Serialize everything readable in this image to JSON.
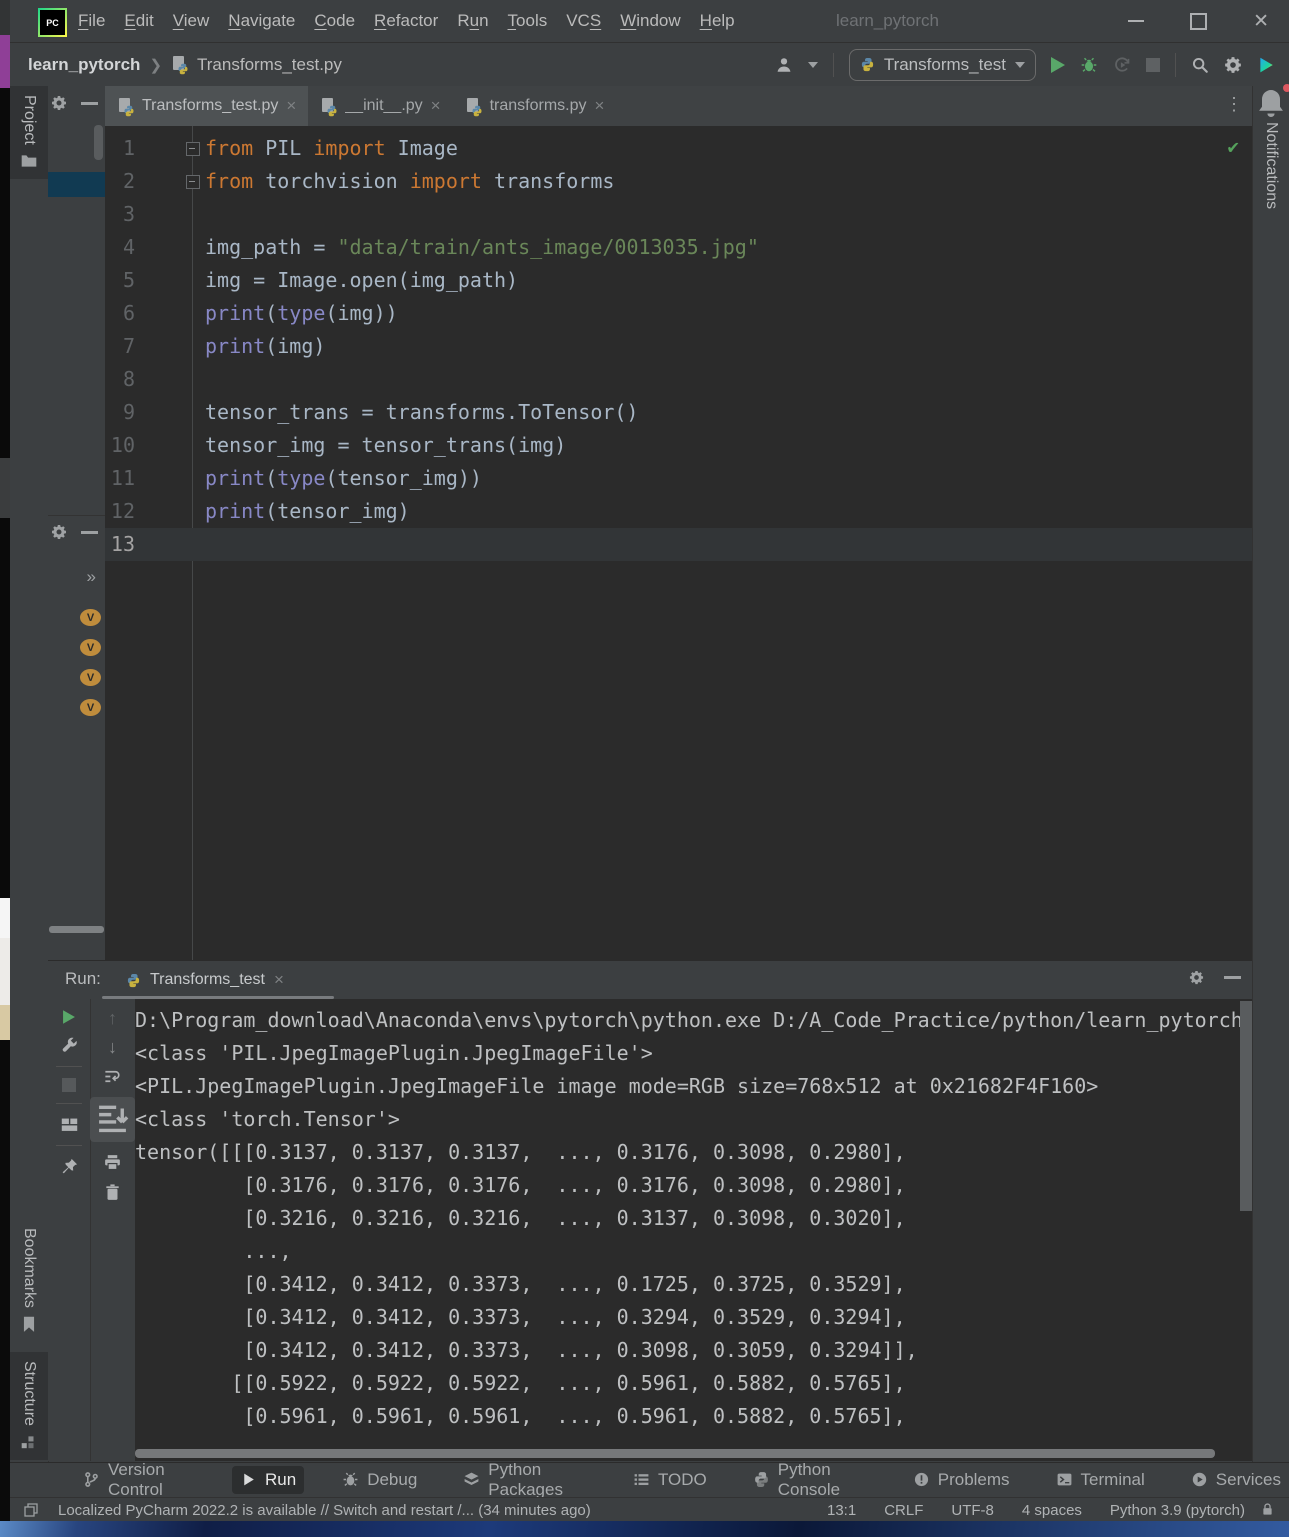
{
  "titlebar": {
    "app_label": "PC",
    "title": "learn_pytorch",
    "menus": [
      {
        "label": "File",
        "u": 0
      },
      {
        "label": "Edit",
        "u": 0
      },
      {
        "label": "View",
        "u": 0
      },
      {
        "label": "Navigate",
        "u": 0
      },
      {
        "label": "Code",
        "u": 0
      },
      {
        "label": "Refactor",
        "u": 0
      },
      {
        "label": "Run",
        "u": 1
      },
      {
        "label": "Tools",
        "u": 0
      },
      {
        "label": "VCS",
        "u": 2
      },
      {
        "label": "Window",
        "u": 0
      },
      {
        "label": "Help",
        "u": 0
      }
    ]
  },
  "toolbar": {
    "breadcrumb_project": "learn_pytorch",
    "breadcrumb_file": "Transforms_test.py",
    "run_config": "Transforms_test"
  },
  "editor": {
    "tabs": [
      {
        "label": "Transforms_test.py",
        "active": true
      },
      {
        "label": "__init__.py",
        "active": false
      },
      {
        "label": "transforms.py",
        "active": false
      }
    ],
    "current_line": 13,
    "lines": [
      {
        "n": 1,
        "t": [
          [
            "from",
            "k"
          ],
          [
            " PIL ",
            "d"
          ],
          [
            "import",
            "k"
          ],
          [
            " Image",
            "d"
          ]
        ]
      },
      {
        "n": 2,
        "t": [
          [
            "from",
            "k"
          ],
          [
            " torchvision ",
            "d"
          ],
          [
            "import",
            "k"
          ],
          [
            " transforms",
            "d"
          ]
        ]
      },
      {
        "n": 3,
        "t": []
      },
      {
        "n": 4,
        "t": [
          [
            "img_path = ",
            "d"
          ],
          [
            "\"data/train/ants_image/0013035.jpg\"",
            "s"
          ]
        ]
      },
      {
        "n": 5,
        "t": [
          [
            "img = Image.open(img_path)",
            "d"
          ]
        ]
      },
      {
        "n": 6,
        "t": [
          [
            "print",
            "b"
          ],
          [
            "(",
            "d"
          ],
          [
            "type",
            "b"
          ],
          [
            "(img))",
            "d"
          ]
        ]
      },
      {
        "n": 7,
        "t": [
          [
            "print",
            "b"
          ],
          [
            "(img)",
            "d"
          ]
        ]
      },
      {
        "n": 8,
        "t": []
      },
      {
        "n": 9,
        "t": [
          [
            "tensor_trans = transforms.ToTensor()",
            "d"
          ]
        ]
      },
      {
        "n": 10,
        "t": [
          [
            "tensor_img = tensor_trans(img)",
            "d"
          ]
        ]
      },
      {
        "n": 11,
        "t": [
          [
            "print",
            "b"
          ],
          [
            "(",
            "d"
          ],
          [
            "type",
            "b"
          ],
          [
            "(tensor_img))",
            "d"
          ]
        ]
      },
      {
        "n": 12,
        "t": [
          [
            "print",
            "b"
          ],
          [
            "(tensor_img)",
            "d"
          ]
        ]
      },
      {
        "n": 13,
        "t": []
      }
    ]
  },
  "left_bar": {
    "project_label": "Project",
    "bookmarks_label": "Bookmarks",
    "structure_label": "Structure"
  },
  "right_bar": {
    "notifications_label": "Notifications"
  },
  "structure_panel": {
    "variable_badges": [
      "V",
      "V",
      "V",
      "V"
    ]
  },
  "run_panel": {
    "label": "Run:",
    "tab": "Transforms_test",
    "console_lines": [
      "D:\\Program_download\\Anaconda\\envs\\pytorch\\python.exe D:/A_Code_Practice/python/learn_pytorch",
      "<class 'PIL.JpegImagePlugin.JpegImageFile'>",
      "<PIL.JpegImagePlugin.JpegImageFile image mode=RGB size=768x512 at 0x21682F4F160>",
      "<class 'torch.Tensor'>",
      "tensor([[[0.3137, 0.3137, 0.3137,  ..., 0.3176, 0.3098, 0.2980],",
      "         [0.3176, 0.3176, 0.3176,  ..., 0.3176, 0.3098, 0.2980],",
      "         [0.3216, 0.3216, 0.3216,  ..., 0.3137, 0.3098, 0.3020],",
      "         ...,",
      "         [0.3412, 0.3412, 0.3373,  ..., 0.1725, 0.3725, 0.3529],",
      "         [0.3412, 0.3412, 0.3373,  ..., 0.3294, 0.3529, 0.3294],",
      "         [0.3412, 0.3412, 0.3373,  ..., 0.3098, 0.3059, 0.3294]],",
      "",
      "        [[0.5922, 0.5922, 0.5922,  ..., 0.5961, 0.5882, 0.5765],",
      "         [0.5961, 0.5961, 0.5961,  ..., 0.5961, 0.5882, 0.5765],"
    ]
  },
  "bottom_bar": {
    "items": [
      {
        "label": "Version Control",
        "icon": "branch",
        "active": false
      },
      {
        "label": "Run",
        "icon": "play",
        "active": true
      },
      {
        "label": "Debug",
        "icon": "bug",
        "active": false
      },
      {
        "label": "Python Packages",
        "icon": "packages",
        "active": false
      },
      {
        "label": "TODO",
        "icon": "todo",
        "active": false
      },
      {
        "label": "Python Console",
        "icon": "python",
        "active": false
      },
      {
        "label": "Problems",
        "icon": "problems",
        "active": false
      },
      {
        "label": "Terminal",
        "icon": "terminal",
        "active": false
      },
      {
        "label": "Services",
        "icon": "services",
        "active": false
      }
    ]
  },
  "status_bar": {
    "message": "Localized PyCharm 2022.2 is available // Switch and restart /... (34 minutes ago)",
    "caret": "13:1",
    "line_ending": "CRLF",
    "encoding": "UTF-8",
    "indent": "4 spaces",
    "interpreter": "Python 3.9 (pytorch)"
  },
  "colors": {
    "frame": "#3c3f41",
    "editor_bg": "#2b2b2b",
    "keyword": "#cc7832",
    "string": "#6a8759",
    "builtin": "#8888c6",
    "accent_green": "#59a869",
    "selection_blue": "#113a52",
    "variable_badge": "#bf8c3c"
  }
}
